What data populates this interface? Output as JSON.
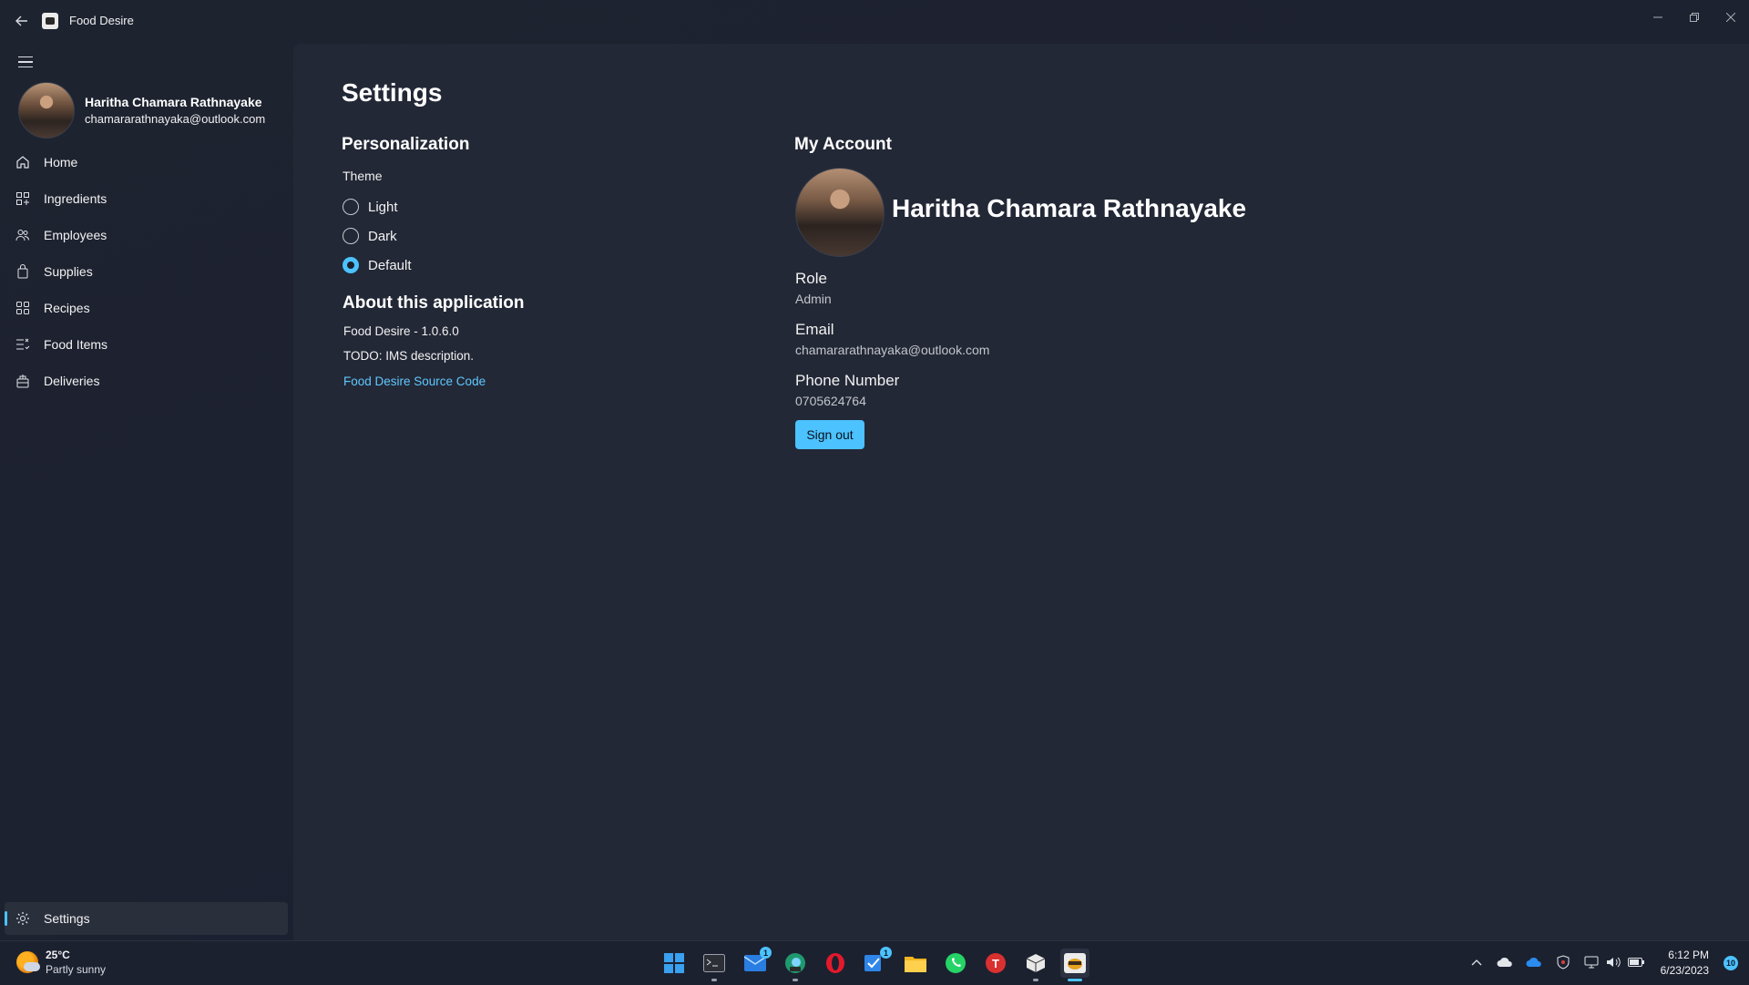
{
  "window": {
    "title": "Food Desire",
    "back_icon": "arrow-left-icon",
    "minimize_icon": "minimize-icon",
    "maximize_icon": "restore-icon",
    "close_icon": "close-icon"
  },
  "sidebar": {
    "menu_icon": "hamburger-icon",
    "profile": {
      "name": "Haritha Chamara Rathnayake",
      "email": "chamararathnayaka@outlook.com"
    },
    "items": [
      {
        "label": "Home",
        "icon": "home-icon"
      },
      {
        "label": "Ingredients",
        "icon": "ingredients-icon"
      },
      {
        "label": "Employees",
        "icon": "employees-icon"
      },
      {
        "label": "Supplies",
        "icon": "supplies-icon"
      },
      {
        "label": "Recipes",
        "icon": "recipes-icon"
      },
      {
        "label": "Food Items",
        "icon": "food-items-icon"
      },
      {
        "label": "Deliveries",
        "icon": "deliveries-icon"
      }
    ],
    "settings": {
      "label": "Settings",
      "icon": "gear-icon",
      "selected": true
    }
  },
  "settings_page": {
    "title": "Settings",
    "personalization": {
      "heading": "Personalization",
      "theme_label": "Theme",
      "options": [
        {
          "label": "Light",
          "checked": false
        },
        {
          "label": "Dark",
          "checked": false
        },
        {
          "label": "Default",
          "checked": true
        }
      ]
    },
    "about": {
      "heading": "About this application",
      "version": "Food Desire - 1.0.6.0",
      "description": "TODO: IMS description.",
      "link": "Food Desire Source Code"
    },
    "account": {
      "heading": "My Account",
      "name": "Haritha Chamara Rathnayake",
      "role_label": "Role",
      "role": "Admin",
      "email_label": "Email",
      "email": "chamararathnayaka@outlook.com",
      "phone_label": "Phone Number",
      "phone": "0705624764",
      "sign_out": "Sign out"
    }
  },
  "taskbar": {
    "weather": {
      "temp": "25°C",
      "desc": "Partly sunny"
    },
    "apps": [
      {
        "name": "start-icon"
      },
      {
        "name": "terminal-icon"
      },
      {
        "name": "mail-icon",
        "badge": "1"
      },
      {
        "name": "edge-dev-icon"
      },
      {
        "name": "opera-icon"
      },
      {
        "name": "todo-icon",
        "badge": "1"
      },
      {
        "name": "file-explorer-icon"
      },
      {
        "name": "whatsapp-icon"
      },
      {
        "name": "t-app-icon"
      },
      {
        "name": "package-icon"
      },
      {
        "name": "food-desire-icon",
        "active": true
      }
    ],
    "tray": [
      "chevron-up-icon",
      "cloud-icon",
      "onedrive-icon",
      "shield-icon",
      "network-icon",
      "volume-icon",
      "battery-icon"
    ],
    "time": "6:12 PM",
    "date": "6/23/2023",
    "notifications": "10"
  },
  "colors": {
    "accent": "#4cc2ff",
    "content_bg": "#232836",
    "window_bg": "#1e2330"
  }
}
